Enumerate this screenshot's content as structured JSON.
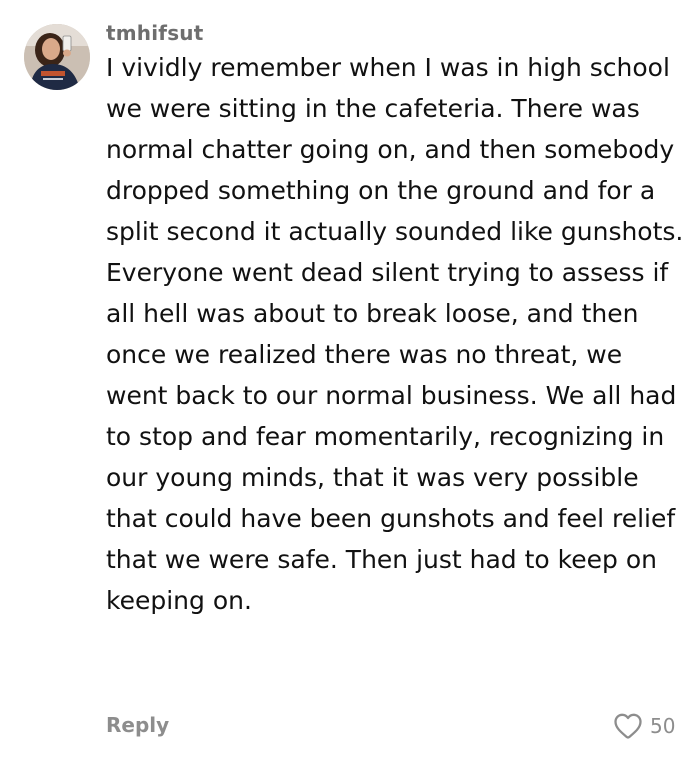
{
  "comment": {
    "username": "tmhifsut",
    "body": "I vividly remember when I was in high school we were sitting in the cafeteria. There was normal chatter going on, and then somebody dropped something on the ground and for a split second it actually sounded like gunshots. Everyone went dead silent trying to assess if all hell was about to break loose, and then once we realized there was no threat, we went back to our normal business. We all had to stop and fear momentarily, recognizing in our young minds, that it was very possible that could have been gunshots and feel relief that we were safe. Then just had to keep on keeping on.",
    "reply_label": "Reply",
    "like_count": "50",
    "like_icon": "heart-outline-icon",
    "avatar_icon": "user-avatar-photo"
  }
}
